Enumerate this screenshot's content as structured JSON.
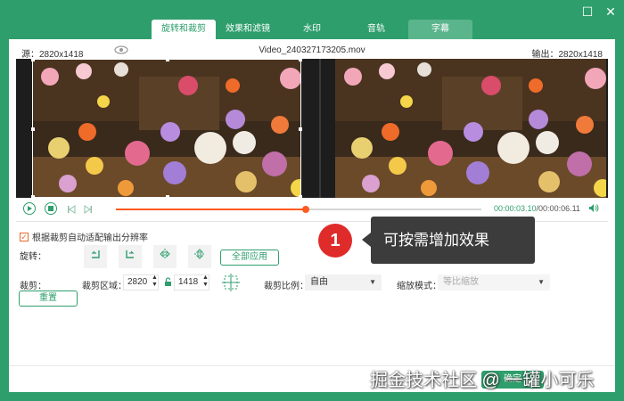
{
  "window": {
    "maximize_glyph": "☐",
    "close_glyph": "✕"
  },
  "tabs": [
    {
      "label": "旋转和裁剪"
    },
    {
      "label": "效果和滤镜"
    },
    {
      "label": "水印"
    },
    {
      "label": "音轨"
    },
    {
      "label": "字幕"
    }
  ],
  "info": {
    "source_label": "源：2820x1418",
    "filename": "Video_240327173205.mov",
    "output_label": "输出：2820x1418"
  },
  "player": {
    "current_time": "00:00:03.10",
    "total_time": "/00:00:06.11",
    "progress": 0.52
  },
  "options": {
    "auto_resolution_label": "根据裁剪自动适配输出分辨率",
    "auto_resolution_checked": true,
    "rotate_label": "旋转：",
    "apply_all_label": "全部应用",
    "crop_label": "裁剪：",
    "crop_area_label": "裁剪区域：",
    "crop_width": "2820",
    "crop_height": "1418",
    "crop_ratio_label": "裁剪比例：",
    "crop_ratio_value": "自由",
    "zoom_mode_label": "缩放模式：",
    "zoom_mode_value": "等比缩放",
    "reset_label": "重置"
  },
  "callout": {
    "number": "1",
    "text": "可按需增加效果"
  },
  "footer": {
    "ok_label": "确定"
  },
  "watermark": {
    "text": "掘金技术社区 @ 一罐小可乐"
  },
  "colors": {
    "accent": "#2e9e6c",
    "progress": "#ff5a1f",
    "callout_badge": "#e02b2b"
  },
  "icons": [
    "eye-icon",
    "play-icon",
    "stop-icon",
    "prev-frame-icon",
    "next-frame-icon",
    "volume-icon",
    "rotate-left-icon",
    "rotate-right-icon",
    "flip-horizontal-icon",
    "flip-vertical-icon",
    "lock-icon",
    "crosshair-icon"
  ]
}
